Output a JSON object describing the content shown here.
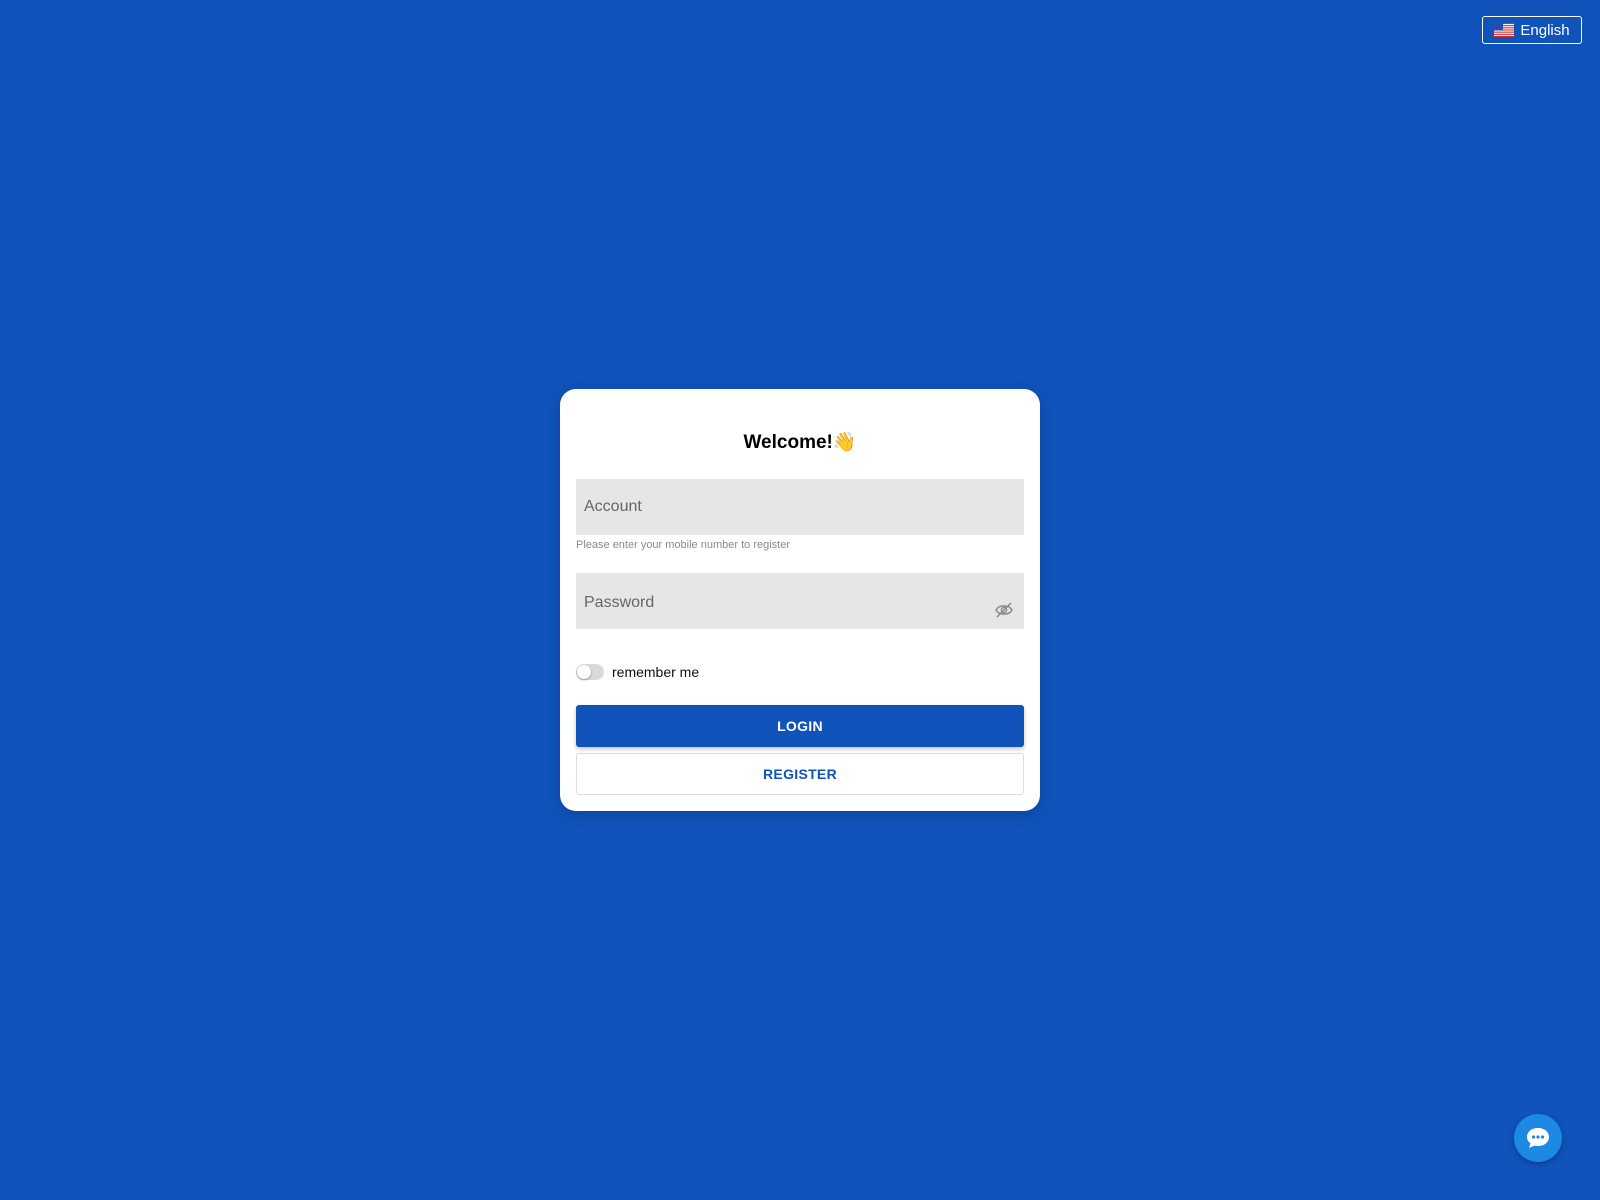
{
  "language": {
    "label": "English",
    "flag_icon": "us-flag-icon"
  },
  "login_card": {
    "title": "Welcome!👋",
    "account": {
      "placeholder": "Account",
      "value": "",
      "hint": "Please enter your mobile number to register"
    },
    "password": {
      "placeholder": "Password",
      "value": "",
      "visibility_icon": "eye-off-icon"
    },
    "remember": {
      "label": "remember me",
      "checked": false
    },
    "login_label": "LOGIN",
    "register_label": "REGISTER"
  },
  "chat": {
    "icon": "chat-bubble-icon"
  },
  "colors": {
    "background": "#0f53bb",
    "primary": "#0f53bb",
    "chat": "#1e88e5",
    "field": "#e6e6e6"
  }
}
